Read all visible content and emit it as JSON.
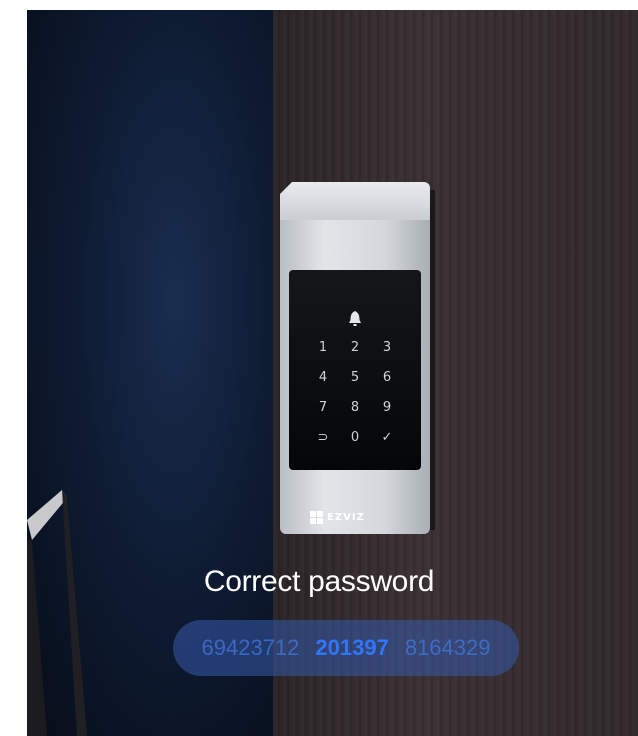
{
  "lock": {
    "brand": "EZVIZ",
    "keys": [
      "1",
      "2",
      "3",
      "4",
      "5",
      "6",
      "7",
      "8",
      "9",
      "⊃",
      "0",
      "✓"
    ]
  },
  "caption": "Correct password",
  "codes": {
    "left": "69423712",
    "main": "201397",
    "right": "8164329"
  },
  "colors": {
    "highlight": "#2f76ff",
    "pill": "#375aaa"
  }
}
